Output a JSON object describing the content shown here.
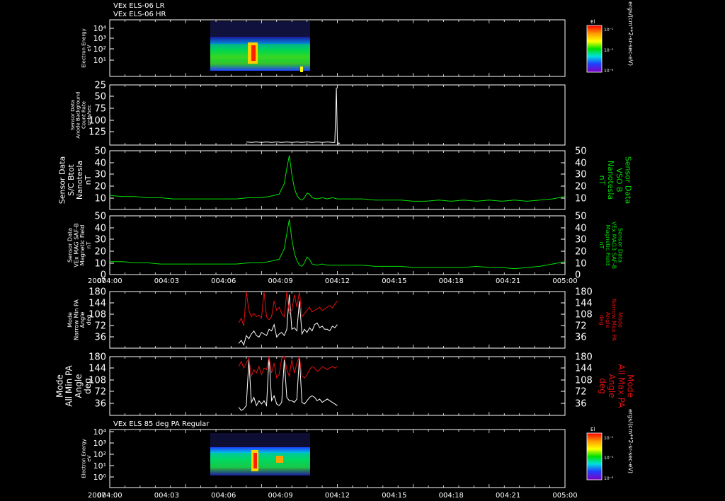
{
  "header": {
    "line1": "VEx ELS-06 LR",
    "line2": "VEx ELS-06 HR",
    "bottom_title": "VEx ELS 85 deg PA Regular"
  },
  "colors": {
    "background": "#000000",
    "axes": "#ffffff",
    "trace_white": "#ffffff",
    "trace_green": "#00e000",
    "trace_red": "#e01010",
    "label_green": "#00dd00",
    "label_red": "#dd1010"
  },
  "time_axis": {
    "year": "2007",
    "tick_labels": [
      "004:00",
      "004:03",
      "004:06",
      "004:09",
      "004:12",
      "004:15",
      "004:18",
      "004:21",
      "005:00"
    ]
  },
  "colorbars": {
    "top": {
      "title": "El",
      "labels": [
        "10⁻¹",
        "10⁻⁵",
        "10⁻⁸"
      ],
      "unit": "ergs/(cm**2-sr-sec-eV)"
    },
    "bottom": {
      "title": "El",
      "labels": [
        "10⁻¹",
        "10⁻⁵",
        "10⁻⁸"
      ],
      "unit": "ergs/(cm**2-sr-sec-eV)"
    }
  },
  "chart_data": [
    {
      "type": "heatmap",
      "panel": "top-spectrogram",
      "ylabel": [
        "Electron Energy",
        "eV"
      ],
      "ytick_labels": [
        "10⁴",
        "10³",
        "10²",
        "10¹"
      ],
      "ylim": [
        1,
        10000
      ],
      "yscale": "log",
      "data_extent_minutes": [
        54,
        90
      ],
      "enhancements_minutes": [
        73.0,
        89.5
      ]
    },
    {
      "type": "line",
      "panel": "anode-background",
      "ylabel": [
        "Sensor Data",
        "Anode Background",
        "Count Rate",
        "cnts/sec"
      ],
      "ytick_labels": [
        "25",
        "50",
        "75",
        "100",
        "125"
      ],
      "ylim": [
        10,
        125
      ],
      "series": [
        {
          "color": "#ffffff",
          "x": [
            54,
            56,
            58,
            60,
            62,
            64,
            66,
            68,
            70,
            72,
            74,
            76,
            78,
            80,
            82,
            84,
            86,
            88,
            89,
            89.6,
            90,
            90.4,
            91
          ],
          "y": [
            16,
            15,
            16,
            15,
            16,
            15,
            16,
            15,
            16,
            15,
            16,
            15,
            16,
            15,
            16,
            15,
            16,
            15,
            15,
            120,
            20,
            12,
            14
          ]
        }
      ]
    },
    {
      "type": "line",
      "panel": "sc-btot",
      "ylabel": [
        "Sensor Data",
        "S/C Btot",
        "Nanotesla",
        "nT"
      ],
      "ylabel_right": [
        "Sensor Data",
        "VSO B",
        "Nanotesla",
        "nT"
      ],
      "ytick_labels": [
        "10",
        "20",
        "30",
        "40",
        "50"
      ],
      "ylim": [
        0,
        50
      ],
      "series": [
        {
          "color": "#00e000",
          "x": [
            0,
            5,
            10,
            15,
            20,
            25,
            30,
            35,
            40,
            45,
            50,
            55,
            60,
            63,
            65,
            67,
            69,
            70,
            71,
            72,
            73,
            74,
            75,
            76,
            77,
            78,
            79,
            80,
            82,
            84,
            86,
            88,
            90,
            95,
            100,
            105,
            110,
            115,
            120,
            125,
            130,
            135,
            140,
            145,
            150,
            155,
            160,
            165,
            170,
            175,
            180
          ],
          "y": [
            12,
            11,
            11,
            10,
            10,
            9,
            9,
            9,
            9,
            9,
            9,
            10,
            10,
            11,
            12,
            13,
            22,
            35,
            46,
            30,
            18,
            12,
            9,
            8,
            10,
            14,
            13,
            10,
            9,
            10,
            9,
            10,
            9,
            9,
            9,
            8,
            8,
            8,
            7,
            7,
            8,
            7,
            8,
            7,
            8,
            7,
            8,
            7,
            8,
            9,
            11
          ]
        }
      ]
    },
    {
      "type": "line",
      "panel": "mag-saf-b",
      "ylabel": [
        "Sensor Data",
        "VEx MAG SAF-B",
        "Magnetic Field",
        "nT"
      ],
      "ylabel_right": [
        "Sensor Data",
        "VEx MAG3 SAF-B",
        "Magnetic Field",
        "nT"
      ],
      "ytick_labels": [
        "0",
        "10",
        "20",
        "30",
        "40",
        "50"
      ],
      "ylim": [
        0,
        50
      ],
      "series": [
        {
          "color": "#00e000",
          "x": [
            0,
            5,
            10,
            15,
            20,
            25,
            30,
            35,
            40,
            45,
            50,
            55,
            60,
            63,
            65,
            67,
            69,
            70,
            71,
            72,
            73,
            74,
            75,
            76,
            77,
            78,
            79,
            80,
            82,
            84,
            86,
            88,
            90,
            95,
            100,
            105,
            110,
            115,
            120,
            125,
            130,
            135,
            140,
            145,
            150,
            155,
            160,
            165,
            170,
            175,
            180
          ],
          "y": [
            11,
            11,
            10,
            10,
            9,
            9,
            9,
            9,
            9,
            9,
            9,
            10,
            10,
            11,
            12,
            13,
            22,
            35,
            47,
            30,
            18,
            12,
            8,
            7,
            10,
            15,
            13,
            9,
            8,
            9,
            8,
            8,
            8,
            8,
            8,
            7,
            7,
            7,
            6,
            6,
            6,
            6,
            6,
            7,
            6,
            6,
            5,
            6,
            7,
            9,
            11
          ]
        }
      ]
    },
    {
      "type": "line",
      "panel": "narrow-pa",
      "ylabel": [
        "Mode",
        "Narrow Min PA",
        "Angle",
        "deg"
      ],
      "ylabel_right": [
        "Mode",
        "Narrow Max PA",
        "Angle",
        "deg"
      ],
      "ytick_labels": [
        "36",
        "72",
        "108",
        "144",
        "180"
      ],
      "ylim": [
        0,
        180
      ],
      "series": [
        {
          "name": "Narrow Min PA",
          "color": "#ffffff",
          "x": [
            51,
            52,
            53,
            54,
            55,
            56,
            57,
            58,
            59,
            60,
            61,
            62,
            63,
            64,
            65,
            66,
            67,
            68,
            69,
            70,
            71,
            72,
            73,
            74,
            75,
            76,
            77,
            78,
            79,
            80,
            81,
            82,
            83,
            84,
            85,
            86,
            87,
            88,
            89,
            90
          ],
          "y": [
            15,
            25,
            10,
            40,
            30,
            45,
            55,
            40,
            35,
            50,
            45,
            40,
            60,
            55,
            75,
            35,
            45,
            50,
            40,
            60,
            170,
            60,
            65,
            55,
            150,
            45,
            60,
            50,
            65,
            55,
            75,
            80,
            65,
            70,
            60,
            60,
            55,
            70,
            65,
            75
          ]
        },
        {
          "name": "Narrow Max PA",
          "color": "#e01010",
          "x": [
            51,
            52,
            53,
            54,
            55,
            56,
            57,
            58,
            59,
            60,
            61,
            62,
            63,
            64,
            65,
            66,
            67,
            68,
            69,
            70,
            71,
            72,
            73,
            74,
            75,
            76,
            77,
            78,
            79,
            80,
            81,
            82,
            83,
            84,
            85,
            86,
            87,
            88,
            89,
            90
          ],
          "y": [
            80,
            95,
            70,
            180,
            120,
            100,
            110,
            100,
            105,
            95,
            180,
            100,
            90,
            100,
            150,
            120,
            130,
            110,
            100,
            180,
            110,
            120,
            170,
            130,
            180,
            100,
            110,
            120,
            130,
            115,
            120,
            125,
            130,
            120,
            125,
            130,
            135,
            128,
            140,
            150
          ]
        }
      ]
    },
    {
      "type": "line",
      "panel": "all-pa",
      "ylabel": [
        "Mode",
        "All Min PA",
        "Angle",
        "deg"
      ],
      "ylabel_right": [
        "Mode",
        "All Max PA",
        "Angle",
        "deg"
      ],
      "ytick_labels": [
        "36",
        "72",
        "108",
        "144",
        "180"
      ],
      "ylim": [
        0,
        180
      ],
      "series": [
        {
          "name": "All Min PA",
          "color": "#ffffff",
          "x": [
            51,
            52,
            53,
            54,
            55,
            56,
            57,
            58,
            59,
            60,
            61,
            62,
            63,
            64,
            65,
            66,
            67,
            68,
            69,
            70,
            71,
            72,
            73,
            74,
            75,
            76,
            77,
            78,
            79,
            80,
            81,
            82,
            83,
            84,
            85,
            86,
            87,
            88,
            89,
            90
          ],
          "y": [
            25,
            15,
            20,
            30,
            170,
            40,
            55,
            30,
            45,
            35,
            45,
            30,
            180,
            45,
            60,
            35,
            30,
            40,
            170,
            55,
            45,
            45,
            40,
            50,
            180,
            40,
            35,
            45,
            55,
            60,
            55,
            45,
            50,
            40,
            45,
            50,
            45,
            40,
            35,
            30
          ]
        },
        {
          "name": "All Max PA",
          "color": "#e01010",
          "x": [
            51,
            52,
            53,
            54,
            55,
            56,
            57,
            58,
            59,
            60,
            61,
            62,
            63,
            64,
            65,
            66,
            67,
            68,
            69,
            70,
            71,
            72,
            73,
            74,
            75,
            76,
            77,
            78,
            79,
            80,
            81,
            82,
            83,
            84,
            85,
            86,
            87,
            88,
            89,
            90
          ],
          "y": [
            150,
            165,
            145,
            160,
            175,
            120,
            140,
            130,
            150,
            125,
            145,
            140,
            180,
            130,
            160,
            115,
            125,
            175,
            180,
            140,
            120,
            170,
            130,
            160,
            180,
            120,
            115,
            125,
            140,
            150,
            145,
            135,
            140,
            150,
            145,
            140,
            145,
            150,
            145,
            150
          ]
        }
      ]
    },
    {
      "type": "heatmap",
      "panel": "bottom-spectrogram",
      "ylabel": [
        "Electron Energy",
        "eV"
      ],
      "ytick_labels": [
        "10⁴",
        "10³",
        "10²",
        "10¹",
        "10⁰"
      ],
      "ylim": [
        1,
        10000
      ],
      "yscale": "log",
      "data_extent_minutes": [
        54,
        90
      ],
      "enhancements_minutes": [
        73.0,
        82.5
      ]
    }
  ]
}
